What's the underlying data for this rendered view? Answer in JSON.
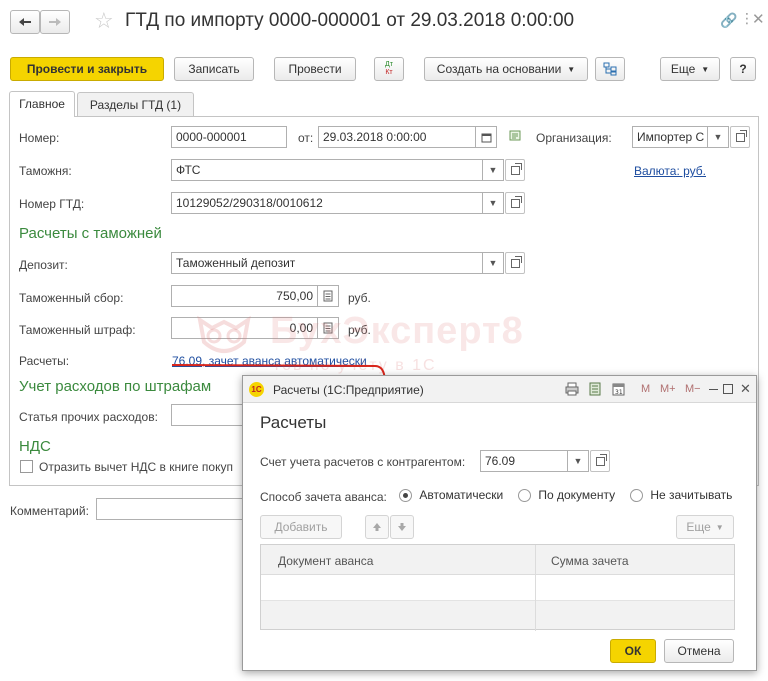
{
  "window": {
    "title": "ГТД по импорту 0000-000001 от 29.03.2018 0:00:00"
  },
  "toolbar": {
    "post_close": "Провести и закрыть",
    "save": "Записать",
    "post": "Провести",
    "dtkt_top": "Дт",
    "dtkt_bottom": "Кт",
    "create_based": "Создать на основании",
    "more": "Еще",
    "help": "?"
  },
  "tabs": [
    "Главное",
    "Разделы ГТД (1)"
  ],
  "form": {
    "number_label": "Номер:",
    "number_value": "0000-000001",
    "date_label": "от:",
    "date_value": "29.03.2018  0:00:00",
    "org_label": "Организация:",
    "org_value": "Импортер С",
    "customs_label": "Таможня:",
    "customs_value": "ФТС",
    "currency_link": "Валюта: руб.",
    "gtd_label": "Номер ГТД:",
    "gtd_value": "10129052/290318/0010612",
    "section_customs": "Расчеты с таможней",
    "deposit_label": "Депозит:",
    "deposit_value": "Таможенный депозит",
    "fee_label": "Таможенный сбор:",
    "fee_value": "750,00",
    "fee_unit": "руб.",
    "fine_label": "Таможенный штраф:",
    "fine_value": "0,00",
    "fine_unit": "руб.",
    "settlements_label": "Расчеты:",
    "settlements_link": "76.09, зачет аванса автоматически",
    "section_fines": "Учет расходов по штрафам",
    "other_expenses_label": "Статья прочих расходов:",
    "section_vat": "НДС",
    "vat_checkbox_label": "Отразить вычет НДС в книге покуп",
    "comment_label": "Комментарий:"
  },
  "watermark": {
    "brand": "БухЭксперт8",
    "subtitle": "тов по учёту в 1С"
  },
  "dialog": {
    "title": "Расчеты (1С:Предприятие)",
    "logo": "1С",
    "tb_m": "M",
    "tb_mplus": "M+",
    "tb_mminus": "M−",
    "heading": "Расчеты",
    "account_label": "Счет учета расчетов с контрагентом:",
    "account_value": "76.09",
    "method_label": "Способ зачета аванса:",
    "method_options": [
      "Автоматически",
      "По документу",
      "Не зачитывать"
    ],
    "method_selected": "Автоматически",
    "add_button": "Добавить",
    "more_button": "Еще",
    "columns": [
      "Документ аванса",
      "Сумма зачета"
    ],
    "ok": "ОК",
    "cancel": "Отмена"
  },
  "colors": {
    "primary_button": "#f5d400",
    "section_green": "#3b8a3e",
    "link_blue": "#1f4ea0",
    "annotation_red": "#d9261c"
  }
}
